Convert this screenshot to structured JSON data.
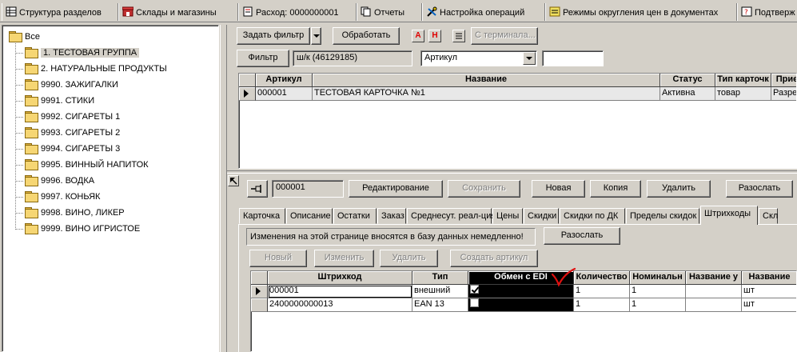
{
  "tabs": [
    {
      "label": "Структура разделов",
      "icon": "grid-icon"
    },
    {
      "label": "Склады и магазины",
      "icon": "store-icon"
    },
    {
      "label": "Расход: 0000000001",
      "icon": "document-icon"
    },
    {
      "label": "Отчеты",
      "icon": "copy-icon"
    },
    {
      "label": "Настройка операций",
      "icon": "tools-icon"
    },
    {
      "label": "Режимы округления цен в документах",
      "icon": "note-icon"
    },
    {
      "label": "Подтверж",
      "icon": "question-icon"
    }
  ],
  "tree": {
    "root": "Все",
    "items": [
      "1. ТЕСТОВАЯ ГРУППА",
      "2. НАТУРАЛЬНЫЕ ПРОДУКТЫ",
      "9990. ЗАЖИГАЛКИ",
      "9991. СТИКИ",
      "9992. СИГАРЕТЫ 1",
      "9993. СИГАРЕТЫ 2",
      "9994. СИГАРЕТЫ 3",
      "9995. ВИННЫЙ НАПИТОК",
      "9996. ВОДКА",
      "9997. КОНЬЯК",
      "9998. ВИНО, ЛИКЕР",
      "9999. ВИНО ИГРИСТОЕ"
    ]
  },
  "toolbar": {
    "set_filter": "Задать фильтр",
    "process": "Обработать",
    "a_label": "A",
    "h_label": "H",
    "from_terminal": "С терминала...",
    "filter": "Фильтр",
    "barcode_field": "ш/к (46129185)",
    "search_by": "Артикул",
    "search_value": ""
  },
  "upper_grid": {
    "headers": [
      "Артикул",
      "Название",
      "Статус",
      "Тип карточк",
      "Прие"
    ],
    "rows": [
      [
        "000001",
        "ТЕСТОВАЯ КАРТОЧКА №1",
        "Активна",
        "товар",
        "Разре"
      ]
    ]
  },
  "card_toolbar": {
    "pin_icon": "pin-icon",
    "article": "000001",
    "edit": "Редактирование",
    "save": "Сохранить",
    "new": "Новая",
    "copy": "Копия",
    "delete": "Удалить",
    "send": "Разослать"
  },
  "property_tabs": [
    "Карточка",
    "Описание",
    "Остатки",
    "Заказ",
    "Среднесут. реал-ция",
    "Цены",
    "Скидки",
    "Скидки по ДК",
    "Пределы скидок",
    "Штрихкоды",
    "Скл"
  ],
  "active_tab": "Штрихкоды",
  "barcodes": {
    "notice": "Изменения на этой странице вносятся в базу данных немедленно!",
    "send": "Разослать",
    "new": "Новый",
    "change": "Изменить",
    "delete": "Удалить",
    "create_article": "Создать артикул",
    "headers": [
      "Штрихкод",
      "Тип",
      "Обмен с EDI",
      "Количество",
      "Номинальн",
      "Название у",
      "Название"
    ],
    "rows": [
      {
        "barcode": "000001",
        "type": "внешний",
        "edi": true,
        "qty": "1",
        "nominal": "1",
        "name_u": "",
        "name": "шт"
      },
      {
        "barcode": "2400000000013",
        "type": "EAN 13",
        "edi": false,
        "qty": "1",
        "nominal": "1",
        "name_u": "",
        "name": "шт"
      }
    ]
  },
  "colors": {
    "accent_red": "#e00000",
    "edi_header": "#000000",
    "edi_mark": "#e01010"
  }
}
